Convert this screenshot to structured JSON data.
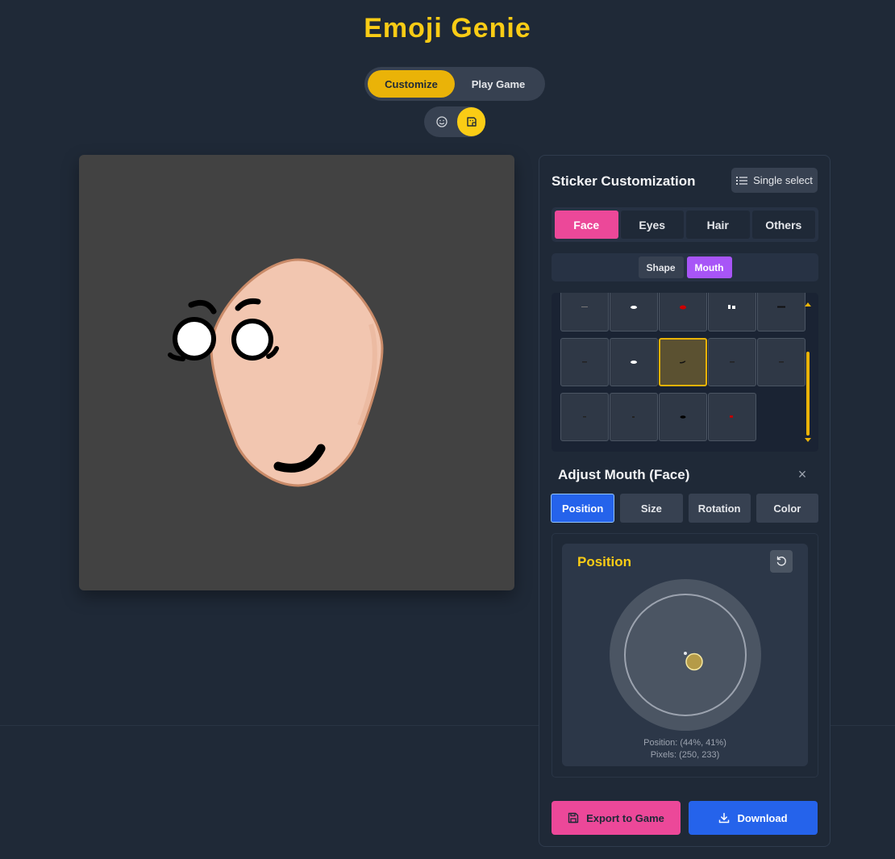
{
  "app": {
    "title": "Emoji Genie"
  },
  "mode_toggle": {
    "customize_label": "Customize",
    "play_label": "Play Game",
    "active": "Customize"
  },
  "type_toggle": {
    "emoji_icon": "smile-icon",
    "sticker_icon": "sticker-icon",
    "active": "sticker"
  },
  "panel": {
    "title": "Sticker Customization",
    "single_select_label": "Single select",
    "category_tabs": [
      "Face",
      "Eyes",
      "Hair",
      "Others"
    ],
    "active_category": "Face",
    "sub_tabs": [
      "Shape",
      "Mouth"
    ],
    "active_sub_tab": "Mouth",
    "selected_item_index": 7
  },
  "adjust": {
    "title": "Adjust Mouth (Face)",
    "close_label": "×",
    "tabs": [
      "Position",
      "Size",
      "Rotation",
      "Color"
    ],
    "active_tab": "Position",
    "position_title": "Position",
    "position_text": "Position: (44%, 41%)",
    "pixels_text": "Pixels: (250, 233)",
    "position_percent": {
      "x": 44,
      "y": 41
    }
  },
  "actions": {
    "export_label": "Export to Game",
    "download_label": "Download"
  },
  "colors": {
    "accent_yellow": "#eab308",
    "accent_pink": "#ec4899",
    "accent_purple": "#a855f7",
    "accent_blue": "#2563eb",
    "face_skin": "#f2c6b0",
    "face_outline": "#c98a68"
  }
}
